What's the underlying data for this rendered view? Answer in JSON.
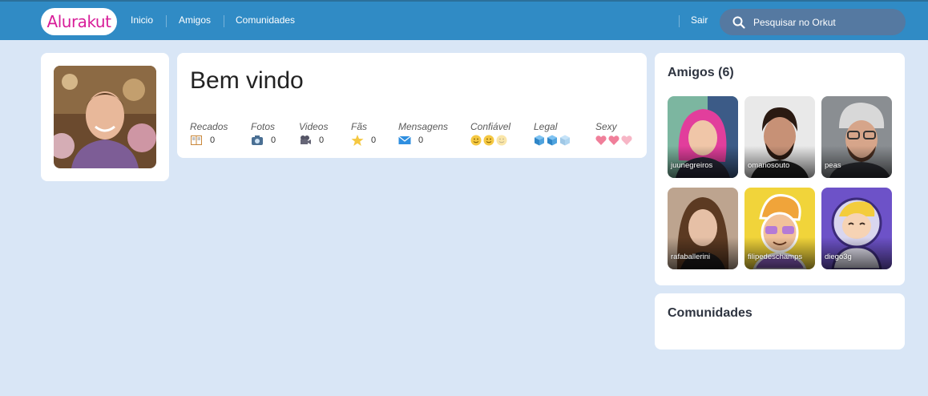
{
  "header": {
    "logo": "Alurakut",
    "nav": [
      "Inicio",
      "Amigos",
      "Comunidades"
    ],
    "logout": "Sair",
    "search_placeholder": "Pesquisar no Orkut"
  },
  "welcome": {
    "title": "Bem vindo",
    "stats": [
      {
        "label": "Recados",
        "value": "0",
        "icon": "book-icon"
      },
      {
        "label": "Fotos",
        "value": "0",
        "icon": "camera-icon"
      },
      {
        "label": "Videos",
        "value": "0",
        "icon": "video-camera-icon"
      },
      {
        "label": "Fãs",
        "value": "0",
        "icon": "star-icon"
      },
      {
        "label": "Mensagens",
        "value": "0",
        "icon": "envelope-icon"
      }
    ],
    "ratings": [
      {
        "label": "Confiável",
        "icon": "smiley-icon",
        "filled": 2,
        "total": 3
      },
      {
        "label": "Legal",
        "icon": "ice-cube-icon",
        "filled": 2,
        "total": 3
      },
      {
        "label": "Sexy",
        "icon": "heart-icon",
        "filled": 2,
        "total": 3
      }
    ]
  },
  "friends": {
    "title": "Amigos (6)",
    "items": [
      {
        "name": "juunegreiros"
      },
      {
        "name": "omariosouto"
      },
      {
        "name": "peas"
      },
      {
        "name": "rafaballerini"
      },
      {
        "name": "filipedeschamps"
      },
      {
        "name": "diego3g"
      }
    ]
  },
  "communities": {
    "title": "Comunidades"
  },
  "colors": {
    "topbar": "#308bc5",
    "background": "#d9e6f6",
    "logo": "#d81d99",
    "search": "#5579a1"
  }
}
